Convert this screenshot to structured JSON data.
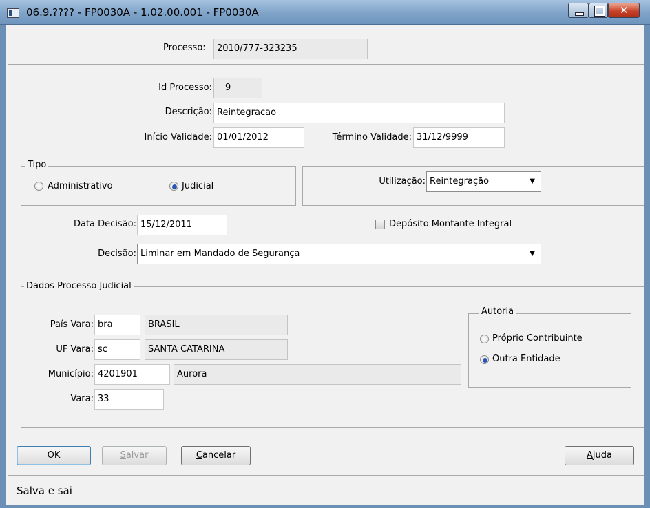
{
  "window": {
    "title": "06.9.???? - FP0030A - 1.02.00.001 - FP0030A"
  },
  "header": {
    "processo_label": "Processo:",
    "processo_value": "2010/777-323235"
  },
  "form": {
    "id_processo_label": "Id Processo:",
    "id_processo_value": "9",
    "descricao_label": "Descrição:",
    "descricao_value": "Reintegracao",
    "inicio_label": "Início Validade:",
    "inicio_value": "01/01/2012",
    "termino_label": "Término Validade:",
    "termino_value": "31/12/9999"
  },
  "tipo": {
    "legend": "Tipo",
    "options": [
      {
        "label": "Administrativo",
        "selected": false
      },
      {
        "label": "Judicial",
        "selected": true
      }
    ]
  },
  "utilizacao": {
    "label": "Utilização:",
    "value": "Reintegração"
  },
  "decisao": {
    "data_label": "Data Decisão:",
    "data_value": "15/12/2011",
    "deposito_label": "Depósito Montante Integral",
    "deposito_checked": false,
    "decisao_label": "Decisão:",
    "decisao_value": "Liminar em Mandado de Segurança"
  },
  "judicial": {
    "legend": "Dados Processo Judicial",
    "pais_label": "País Vara:",
    "pais_code": "bra",
    "pais_name": "BRASIL",
    "uf_label": "UF Vara:",
    "uf_code": "sc",
    "uf_name": "SANTA CATARINA",
    "municipio_label": "Município:",
    "municipio_code": "4201901",
    "municipio_name": "Aurora",
    "vara_label": "Vara:",
    "vara_value": "33"
  },
  "autoria": {
    "legend": "Autoria",
    "options": [
      {
        "label": "Próprio Contribuinte",
        "selected": false
      },
      {
        "label": "Outra Entidade",
        "selected": true
      }
    ]
  },
  "buttons": {
    "ok": "OK",
    "salvar_first": "S",
    "salvar_rest": "alvar",
    "cancelar_first": "C",
    "cancelar_rest": "ancelar",
    "ajuda_first": "A",
    "ajuda_rest": "juda"
  },
  "status": {
    "text": "Salva e sai"
  },
  "colors": {
    "titlebar": "#7fa3c8",
    "panel": "#f1f1f1",
    "close": "#c8432a",
    "radio_dot": "#2a55b5"
  }
}
